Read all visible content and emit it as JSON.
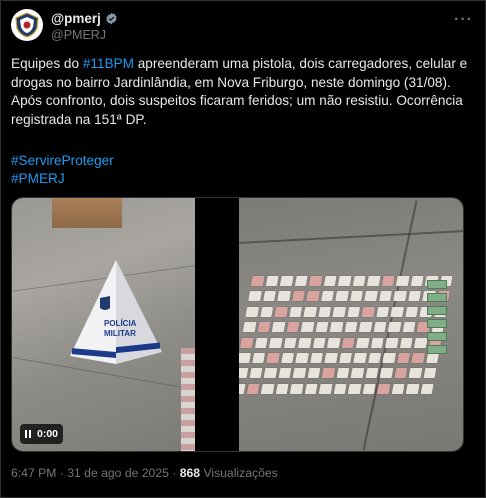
{
  "tweet": {
    "display_name": "@pmerj",
    "handle": "@PMERJ",
    "more_label": "···",
    "text_before_link": "Equipes do ",
    "link_text": "#11BPM",
    "text_after_link": " apreenderam uma pistola, dois carregadores, celular e drogas no bairro Jardinlândia, em Nova Friburgo, neste domingo (31/08). Após confronto, dois suspeitos ficaram feridos; um não resistiu. Ocorrência registrada na 151ª DP.",
    "hashtag_1": "#ServireProteger",
    "hashtag_2": "#PMERJ",
    "video_time": "0:00",
    "cone_label_1": "POLÍCIA",
    "cone_label_2": "MILITAR",
    "timestamp": "6:47 PM · 31 de ago de 2025 · ",
    "views_count": "868",
    "views_label": " Visualizações"
  },
  "colors": {
    "background": "#000000",
    "text": "#e7e9ea",
    "secondary": "#71767b",
    "link": "#1d9bf0",
    "verified": "#829aab"
  },
  "icons": {
    "verified": "verified-badge-icon",
    "more": "more-icon",
    "pause": "pause-icon"
  }
}
